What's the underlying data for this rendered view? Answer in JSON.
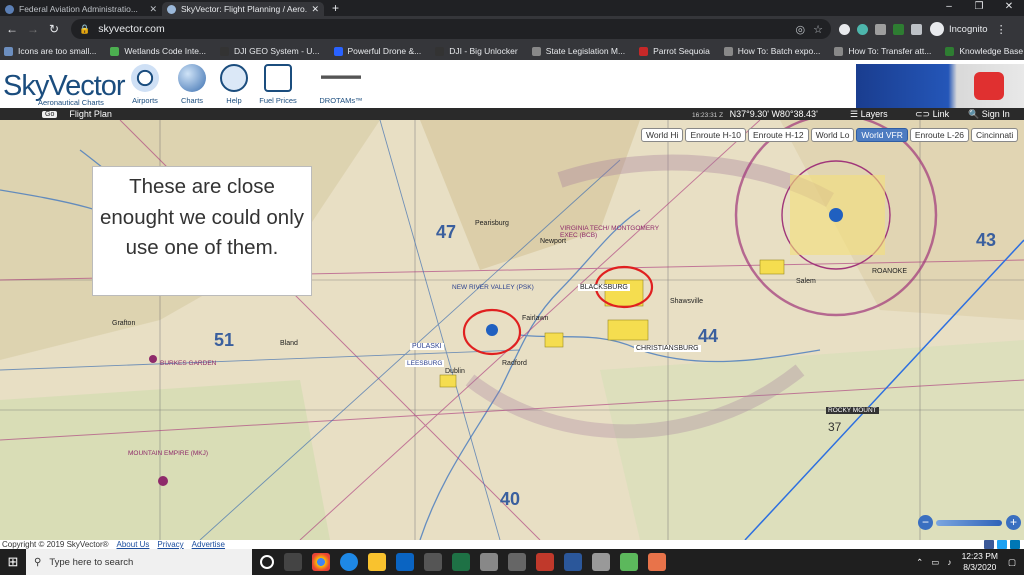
{
  "browser": {
    "tabs": [
      {
        "title": "Federal Aviation Administratio...",
        "active": false
      },
      {
        "title": "SkyVector: Flight Planning / Aero...",
        "active": true
      }
    ],
    "url": "skyvector.com",
    "incognito_label": "Incognito",
    "bookmarks": [
      {
        "label": "Icons are too small...",
        "color": "#6c8ebf"
      },
      {
        "label": "Wetlands Code Inte...",
        "color": "#4caf50"
      },
      {
        "label": "DJI GEO System - U...",
        "color": "#333333"
      },
      {
        "label": "Powerful Drone &...",
        "color": "#2962ff"
      },
      {
        "label": "DJI - Big Unlocker",
        "color": "#333333"
      },
      {
        "label": "State Legislation M...",
        "color": "#888888"
      },
      {
        "label": "Parrot Sequoia",
        "color": "#c62828"
      },
      {
        "label": "How To: Batch expo...",
        "color": "#888888"
      },
      {
        "label": "How To: Transfer att...",
        "color": "#888888"
      },
      {
        "label": "Knowledge Base - S...",
        "color": "#2e7d32"
      }
    ]
  },
  "skyvector": {
    "logo": "SkyVector",
    "logo_sub": "Aeronautical Charts",
    "nav": [
      {
        "label": "Airports",
        "icon": "airport-icon"
      },
      {
        "label": "Charts",
        "icon": "globe-icon"
      },
      {
        "label": "Help",
        "icon": "help-icon"
      },
      {
        "label": "Fuel Prices",
        "icon": "fuel-icon"
      },
      {
        "label": "DROTAMs™",
        "icon": "drone-icon"
      }
    ],
    "toolbar": {
      "go_label": "Go",
      "flight_plan": "Flight Plan",
      "zulu_time": "16:23:31 Z",
      "coordinates": "N37°9.30' W80°38.43'",
      "layers": "Layers",
      "link": "Link",
      "sign_in": "Sign In"
    },
    "chart_buttons": [
      {
        "label": "World Hi",
        "active": false
      },
      {
        "label": "Enroute H-10",
        "active": false
      },
      {
        "label": "Enroute H-12",
        "active": false
      },
      {
        "label": "World Lo",
        "active": false
      },
      {
        "label": "World VFR",
        "active": true
      },
      {
        "label": "Enroute L-26",
        "active": false
      },
      {
        "label": "Cincinnati",
        "active": false
      }
    ],
    "callout_text": "These are close enought we could only use one of them.",
    "map_labels": {
      "pulaski": "PULASKI",
      "blacksburg": "BLACKSBURG",
      "christiansburg": "CHRISTIANSBURG",
      "roanoke": "ROANOKE",
      "salem": "Salem",
      "burkes_garden": "BURKES GARDEN",
      "mountain_empire": "MOUNTAIN EMPIRE (MKJ)",
      "new_river_valley": "NEW RIVER VALLEY (PSK)",
      "virginia_tech": "VIRGINIA TECH/ MONTGOMERY EXEC (BCB)",
      "leesburg": "LEESBURG",
      "bland": "Bland",
      "grafton": "Grafton",
      "radford": "Radford",
      "dublin": "Dublin",
      "pearisburg": "Pearisburg",
      "newport": "Newport",
      "fairlawn": "Fairlawn",
      "shawsville": "Shawsville",
      "rocky_mount": "ROCKY MOUNT",
      "copy_area": "44",
      "area_47": "47",
      "area_51": "51",
      "area_40": "40",
      "area_43": "43",
      "area_37": "37"
    }
  },
  "footer": {
    "copyright": "Copyright © 2019 SkyVector®",
    "links": [
      "About Us",
      "Privacy",
      "Advertise"
    ]
  },
  "taskbar": {
    "search_placeholder": "Type here to search",
    "time": "12:23 PM",
    "date": "8/3/2020"
  }
}
